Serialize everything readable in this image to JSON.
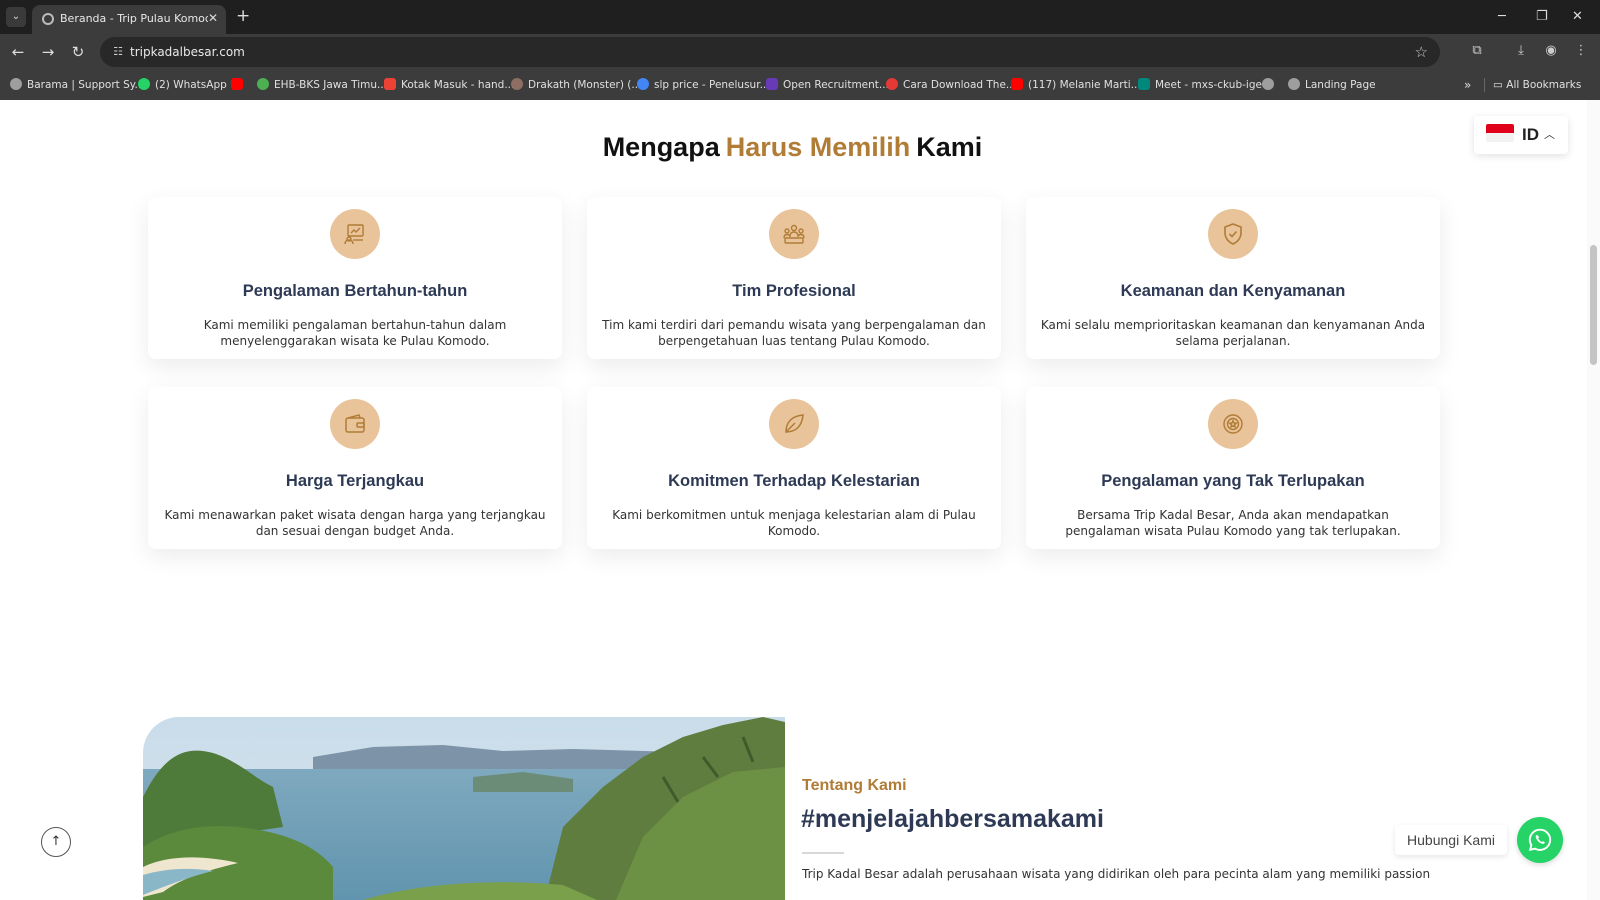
{
  "browser": {
    "tab_title": "Beranda - Trip Pulau Komodo",
    "url": "tripkadalbesar.com",
    "bookmarks": [
      {
        "label": "Barama | Support Sy...",
        "color": "#9e9e9e"
      },
      {
        "label": "(2) WhatsApp",
        "color": "#25d366"
      },
      {
        "label": "",
        "color": "#ff0000"
      },
      {
        "label": "EHB-BKS Jawa Timu...",
        "color": "#4caf50"
      },
      {
        "label": "Kotak Masuk - hand...",
        "color": "#ea4335"
      },
      {
        "label": "Drakath (Monster) (...",
        "color": "#8d6e63"
      },
      {
        "label": "slp price - Penelusur...",
        "color": "#4285f4"
      },
      {
        "label": "Open Recruitment...",
        "color": "#673ab7"
      },
      {
        "label": "Cara Download The...",
        "color": "#e53935"
      },
      {
        "label": "(117) Melanie Marti...",
        "color": "#ff0000"
      },
      {
        "label": "Meet - mxs-ckub-ige",
        "color": "#00897b"
      },
      {
        "label": "",
        "color": "#9e9e9e"
      },
      {
        "label": "Landing Page",
        "color": "#9e9e9e"
      }
    ],
    "all_bookmarks": "All Bookmarks"
  },
  "section": {
    "title_part1": "Mengapa",
    "title_accent": "Harus Memilih",
    "title_part2": "Kami"
  },
  "features": [
    {
      "icon": "experience-icon",
      "title": "Pengalaman Bertahun-tahun",
      "text": "Kami memiliki pengalaman bertahun-tahun dalam menyelenggarakan wisata ke Pulau Komodo."
    },
    {
      "icon": "team-icon",
      "title": "Tim Profesional",
      "text": "Tim kami terdiri dari pemandu wisata yang berpengalaman dan berpengetahuan luas tentang Pulau Komodo."
    },
    {
      "icon": "shield-check-icon",
      "title": "Keamanan dan Kenyamanan",
      "text": "Kami selalu memprioritaskan keamanan dan kenyamanan Anda selama perjalanan."
    },
    {
      "icon": "wallet-icon",
      "title": "Harga Terjangkau",
      "text": "Kami menawarkan paket wisata dengan harga yang terjangkau dan sesuai dengan budget Anda."
    },
    {
      "icon": "leaf-icon",
      "title": "Komitmen Terhadap Kelestarian",
      "text": "Kami berkomitmen untuk menjaga kelestarian alam di Pulau Komodo."
    },
    {
      "icon": "award-badge-icon",
      "title": "Pengalaman yang Tak Terlupakan",
      "text": "Bersama Trip Kadal Besar, Anda akan mendapatkan pengalaman wisata Pulau Komodo yang tak terlupakan."
    }
  ],
  "language": {
    "code": "ID"
  },
  "about": {
    "eyebrow": "Tentang Kami",
    "heading": "#menjelajahbersamakami",
    "text": "Trip Kadal Besar adalah perusahaan wisata yang didirikan oleh para pecinta alam yang memiliki passion"
  },
  "contact": {
    "label": "Hubungi Kami"
  },
  "colors": {
    "accent": "#b07c36",
    "icon_bg": "#e9c49a",
    "heading": "#2e3a55",
    "whatsapp": "#25d366"
  }
}
